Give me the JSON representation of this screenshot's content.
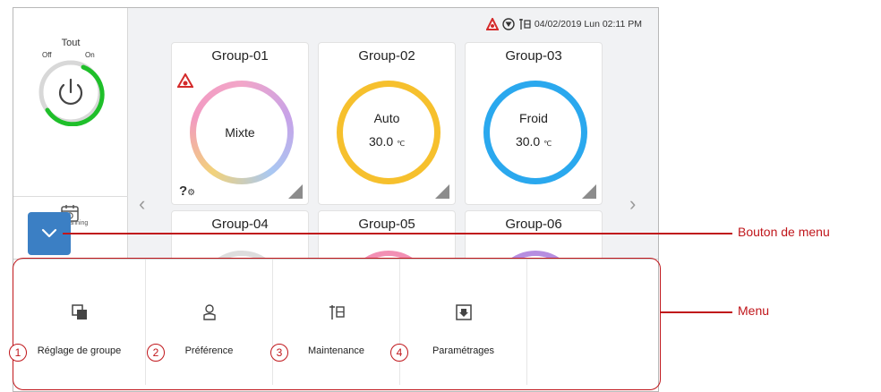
{
  "status": {
    "icons": [
      "alarm-icon",
      "filter-icon",
      "maintenance-icon"
    ],
    "datetime": "04/02/2019 Lun 02:11 PM"
  },
  "sidebar": {
    "title": "Tout",
    "off_label": "Off",
    "on_label": "On",
    "planning_label": "Planning"
  },
  "groups": [
    {
      "title": "Group-01",
      "mode": "Mixte",
      "temperature": "",
      "unit": ""
    },
    {
      "title": "Group-02",
      "mode": "Auto",
      "temperature": "30.0",
      "unit": "℃"
    },
    {
      "title": "Group-03",
      "mode": "Froid",
      "temperature": "30.0",
      "unit": "℃"
    },
    {
      "title": "Group-04"
    },
    {
      "title": "Group-05"
    },
    {
      "title": "Group-06"
    }
  ],
  "menu": {
    "items": [
      {
        "number": "1",
        "label": "Réglage de groupe",
        "icon": "group-setting-icon"
      },
      {
        "number": "2",
        "label": "Préférence",
        "icon": "preference-icon"
      },
      {
        "number": "3",
        "label": "Maintenance",
        "icon": "maintenance-icon"
      },
      {
        "number": "4",
        "label": "Paramétrages",
        "icon": "settings-icon"
      }
    ]
  },
  "callouts": {
    "menu_button": "Bouton de menu",
    "menu": "Menu"
  },
  "colors": {
    "accent_blue": "#3b7fc4",
    "annotation_red": "#c0161b",
    "power_green": "#1fbf2a",
    "ring_auto": "#f6c02d",
    "ring_froid": "#2aa8ee"
  }
}
